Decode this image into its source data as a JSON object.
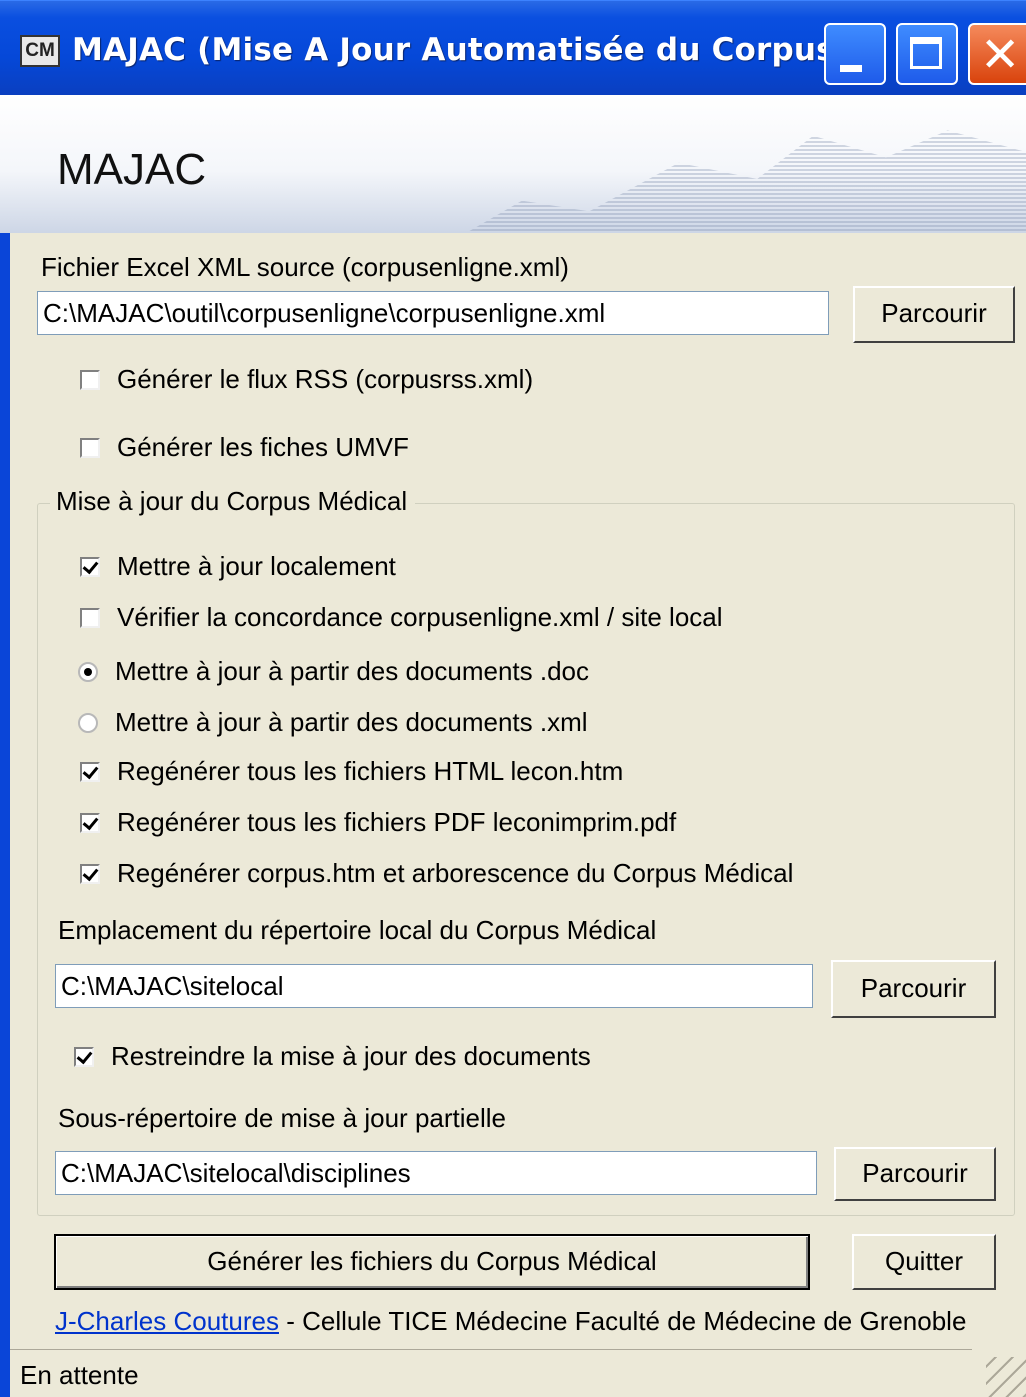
{
  "window": {
    "icon_text": "CM",
    "title": "MAJAC (Mise A Jour Automatisée du Corpus)"
  },
  "banner": {
    "title": "MAJAC"
  },
  "source": {
    "label": "Fichier Excel XML source (corpusenligne.xml)",
    "path": "C:\\MAJAC\\outil\\corpusenligne\\corpusenligne.xml",
    "browse_label": "Parcourir"
  },
  "options": {
    "rss": {
      "label": "Générer le flux RSS (corpusrss.xml)",
      "checked": false
    },
    "umvf": {
      "label": "Générer les fiches UMVF",
      "checked": false
    }
  },
  "group": {
    "legend": "Mise à jour du Corpus Médical",
    "items": [
      {
        "type": "checkbox",
        "label": "Mettre à jour localement",
        "checked": true
      },
      {
        "type": "checkbox",
        "label": "Vérifier la concordance corpusenligne.xml / site local",
        "checked": false
      },
      {
        "type": "radio",
        "label": "Mettre à jour à partir des documents .doc",
        "checked": true
      },
      {
        "type": "radio",
        "label": "Mettre à jour à partir des documents .xml",
        "checked": false
      },
      {
        "type": "checkbox",
        "label": "Regénérer tous les fichiers HTML lecon.htm",
        "checked": true
      },
      {
        "type": "checkbox",
        "label": "Regénérer tous les fichiers PDF leconimprim.pdf",
        "checked": true
      },
      {
        "type": "checkbox",
        "label": "Regénérer corpus.htm et arborescence du Corpus Médical",
        "checked": true
      }
    ],
    "local_dir_label": "Emplacement du répertoire local du Corpus Médical",
    "local_dir_path": "C:\\MAJAC\\sitelocal",
    "local_dir_browse": "Parcourir",
    "restrict": {
      "label": "Restreindre la mise à jour des documents",
      "checked": true
    },
    "sub_dir_label": "Sous-répertoire de mise à jour partielle",
    "sub_dir_path": "C:\\MAJAC\\sitelocal\\disciplines",
    "sub_dir_browse": "Parcourir"
  },
  "actions": {
    "generate_label": "Générer les fichiers du Corpus Médical",
    "quit_label": "Quitter"
  },
  "footer": {
    "author_link": "J-Charles Coutures",
    "credit": " - Cellule TICE Médecine Faculté de Médecine de Grenoble"
  },
  "status": {
    "text": "En attente"
  }
}
